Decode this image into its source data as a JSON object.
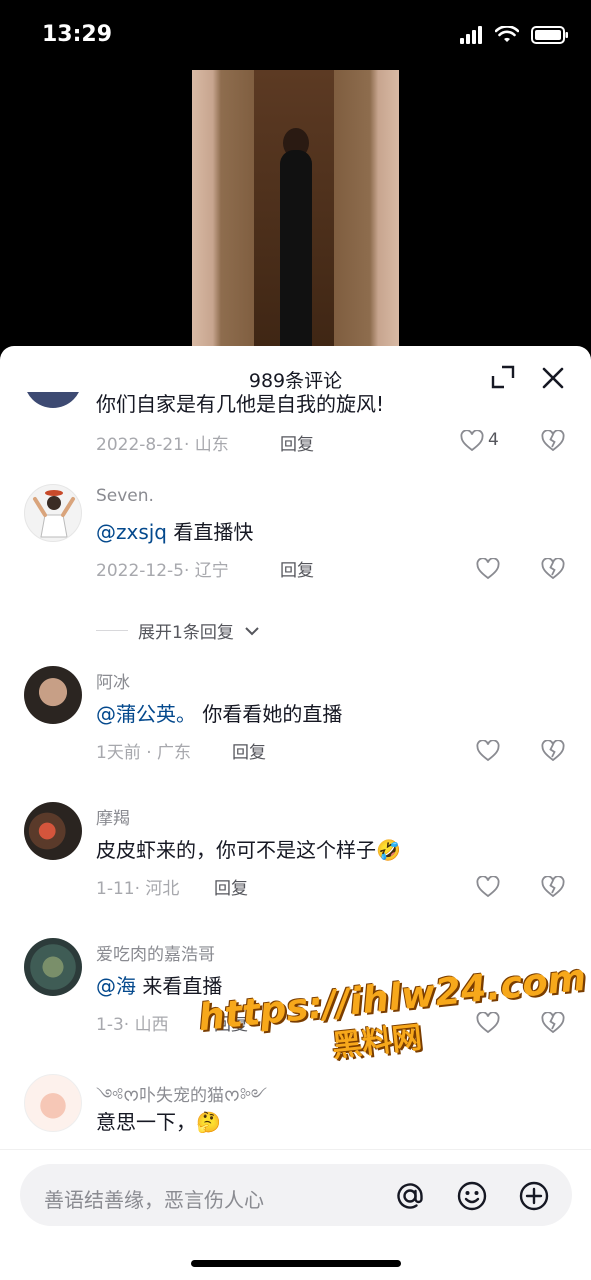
{
  "status_bar": {
    "time": "13:29"
  },
  "sheet": {
    "title": "989条评论"
  },
  "comments": [
    {
      "user": "",
      "text": "你们自家是有几他是自我的旋风!",
      "meta": "2022-8-21· 山东",
      "reply_label": "回复",
      "likes": "4"
    },
    {
      "user": "Seven.",
      "mention": "@zxsjq",
      "text": " 看直播快",
      "meta": "2022-12-5· 辽宁",
      "reply_label": "回复",
      "likes": ""
    },
    {
      "user": "阿冰",
      "mention": "@蒲公英。",
      "text": " 你看看她的直播",
      "meta": "1天前 · 广东",
      "reply_label": "回复",
      "likes": ""
    },
    {
      "user": "摩羯",
      "text": "皮皮虾来的，你可不是这个样子🤣",
      "meta": "1-11· 河北",
      "reply_label": "回复",
      "likes": ""
    },
    {
      "user": "爱吃肉的嘉浩哥",
      "mention": "@海",
      "text": " 来看直播",
      "meta": "1-3· 山西",
      "reply_label": "回复",
      "likes": ""
    },
    {
      "user": "༺ᰔ卟失宠的猫ᰔ༻",
      "text": "意思一下，🤔",
      "meta": "",
      "reply_label": "",
      "likes": ""
    }
  ],
  "expand_replies": {
    "label": "展开1条回复"
  },
  "watermark": {
    "url": "https://ihlw24.com",
    "name": "黑料网"
  },
  "input": {
    "placeholder": "善语结善缘，恶言伤人心"
  },
  "icons": {
    "signal": "signal-icon",
    "wifi": "wifi-icon",
    "battery": "battery-icon",
    "expand": "expand-icon",
    "close": "close-icon",
    "like": "heart-icon",
    "dislike": "broken-heart-icon",
    "mention": "at-icon",
    "emoji": "emoji-icon",
    "add": "plus-circle-icon"
  }
}
